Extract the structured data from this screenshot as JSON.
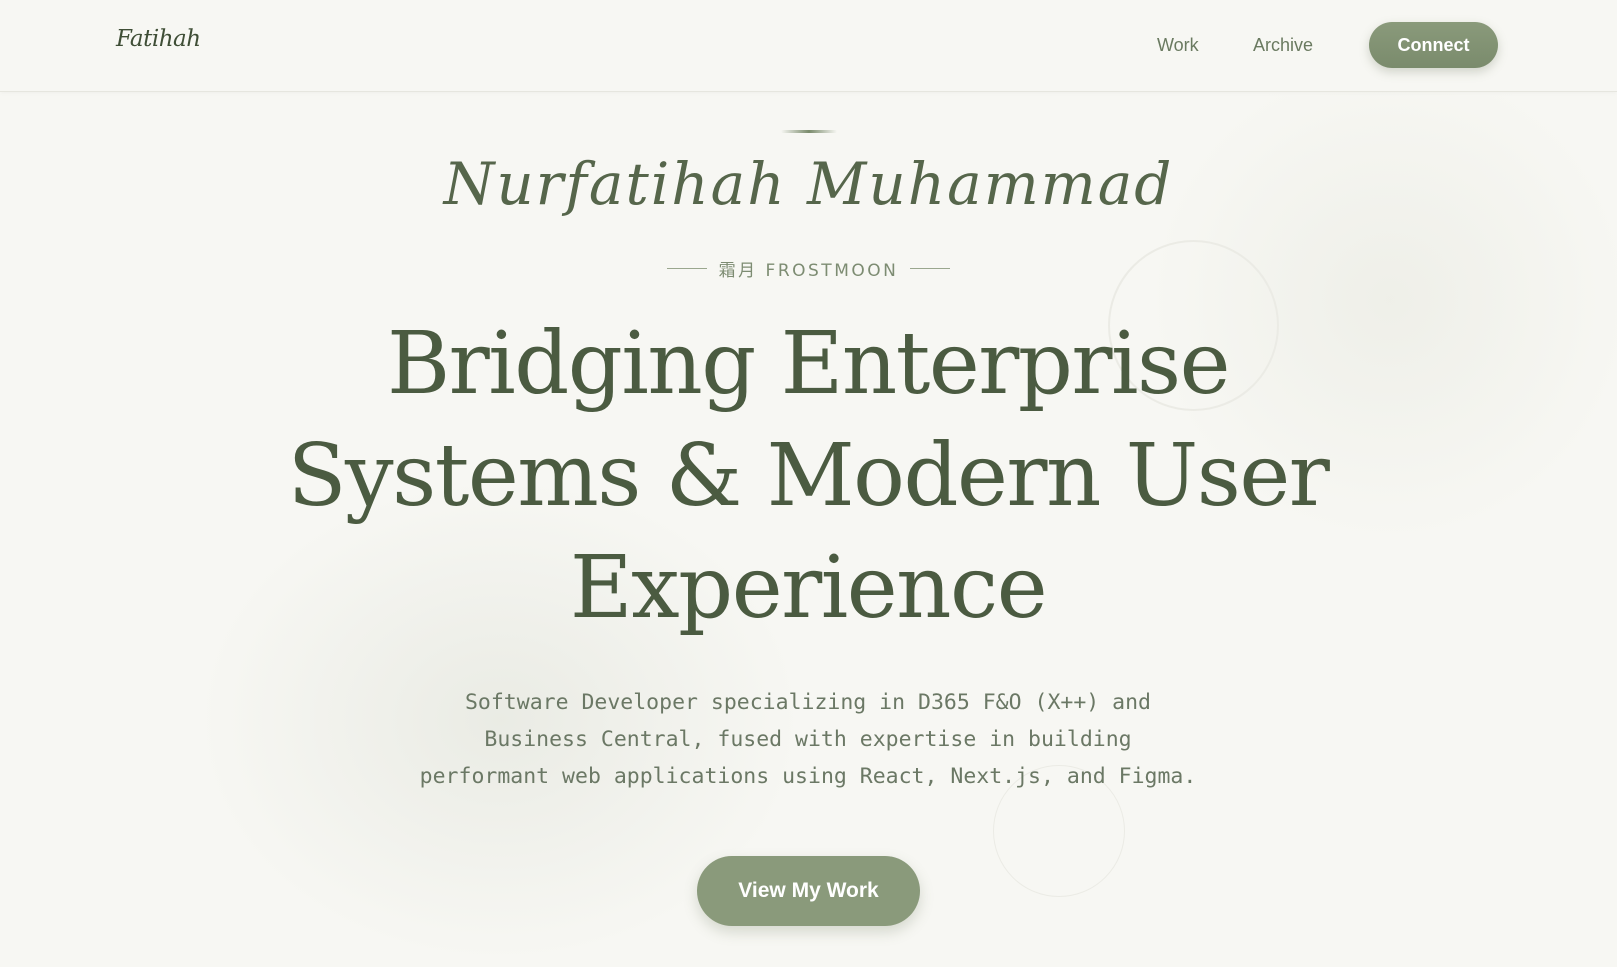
{
  "header": {
    "logo_text": "Fatihah",
    "nav": {
      "work": "Work",
      "archive": "Archive"
    },
    "connect_label": "Connect"
  },
  "hero": {
    "signature_name": "Nurfatihah Muhammad",
    "subtitle": "霜月 FROSTMOON",
    "headline_lines": [
      "Bridging Enterprise",
      "Systems & Modern User",
      "Experience"
    ],
    "description_lines": [
      "Software Developer specializing in D365 F&O (X++) and",
      "Business Central, fused with expertise in building",
      "performant web applications using React, Next.js, and Figma."
    ],
    "cta_label": "View My Work"
  },
  "colors": {
    "background": "#f7f7f3",
    "text_primary": "#4b5b41",
    "accent": "#8a9a7b"
  }
}
